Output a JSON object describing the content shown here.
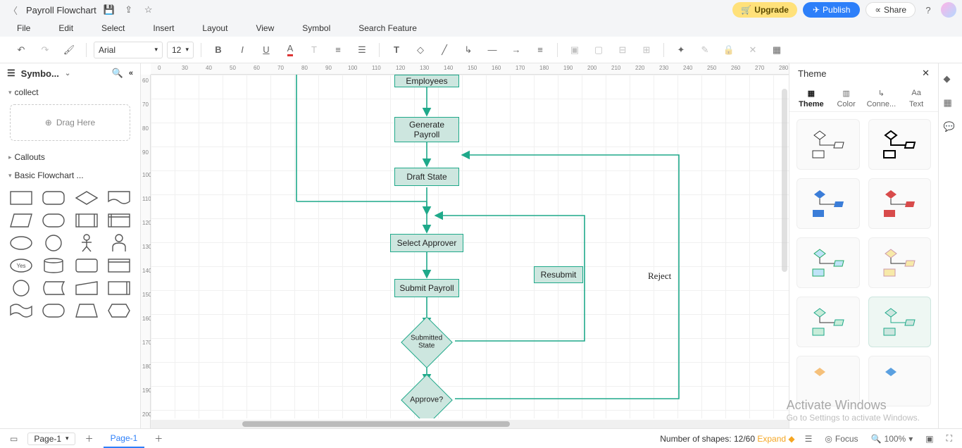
{
  "header": {
    "title": "Payroll Flowchart",
    "upgrade": "Upgrade",
    "publish": "Publish",
    "share": "Share"
  },
  "menu": [
    "File",
    "Edit",
    "Select",
    "Insert",
    "Layout",
    "View",
    "Symbol",
    "Search Feature"
  ],
  "toolbar": {
    "font": "Arial",
    "size": "12"
  },
  "leftpanel": {
    "title": "Symbo...",
    "collect": "collect",
    "draghere": "Drag Here",
    "callouts": "Callouts",
    "basicflow": "Basic Flowchart ..."
  },
  "ruler_h": [
    "0",
    "30",
    "40",
    "50",
    "60",
    "70",
    "80",
    "90",
    "100",
    "110",
    "120",
    "130",
    "140",
    "150",
    "160",
    "170",
    "180",
    "190",
    "200",
    "210",
    "220",
    "230",
    "240",
    "250",
    "260",
    "270",
    "280"
  ],
  "ruler_v": [
    "60",
    "70",
    "80",
    "90",
    "100",
    "110",
    "120",
    "130",
    "140",
    "150",
    "160",
    "170",
    "180",
    "190",
    "200"
  ],
  "nodes": {
    "employees": "Employees",
    "generate": "Generate Payroll",
    "draft": "Draft State",
    "select_approver": "Select Approver",
    "submit": "Submit Payroll",
    "resubmit": "Resubmit",
    "submitted": "Submitted State",
    "approve": "Approve?"
  },
  "labels": {
    "reject": "Reject"
  },
  "rightpanel": {
    "title": "Theme",
    "tabs": [
      "Theme",
      "Color",
      "Conne...",
      "Text"
    ]
  },
  "status": {
    "page": "Page-1",
    "tab": "Page-1",
    "shapes_label": "Number of shapes: ",
    "shapes_value": "12/60",
    "expand": "Expand",
    "focus": "Focus",
    "zoom": "100%"
  },
  "watermark": {
    "l1": "Activate Windows",
    "l2": "Go to Settings to activate Windows."
  },
  "shape_cell_label": "Yes"
}
